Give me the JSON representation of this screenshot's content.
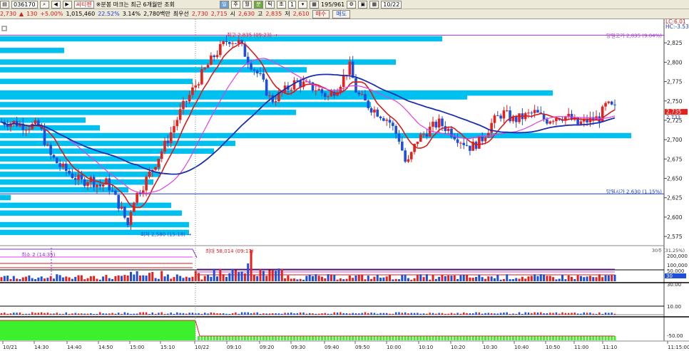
{
  "toolbar1": {
    "code": "036170",
    "name": "씨티젠",
    "status_text": "※분봉 마크는 최근 6개월만 조회",
    "period_value": "1",
    "count_text": "195/961",
    "date": "10/22"
  },
  "toolbar2": {
    "price": "2,730",
    "change": "130",
    "rate": "+5.00%",
    "volume": "1,015,460",
    "vol_rate": "22.52%",
    "turnover": "3.14%",
    "amount": "2,780백만",
    "prev_label": "최우선",
    "ask": "2,730",
    "bid": "2,715",
    "open_label": "시",
    "open": "2,630",
    "high_label": "고",
    "high": "2,835",
    "low_label": "저",
    "low": "2,610",
    "buy_label": "매수",
    "sell_label": "매도"
  },
  "chart_data": {
    "type": "candlestick",
    "price_axis": {
      "min": 2565,
      "max": 2850,
      "ticks": [
        2575,
        2600,
        2625,
        2650,
        2675,
        2700,
        2725,
        2750,
        2775,
        2800,
        2825
      ],
      "tick_labels": [
        "2,575",
        "2,600",
        "2,625",
        "2,650",
        "2,675",
        "2,700",
        "2,725",
        "2,750",
        "2,775",
        "2,800",
        "2,825"
      ]
    },
    "time_labels": [
      "10/21",
      "14:30",
      "14:40",
      "14:50",
      "15:00",
      "15:10",
      "10/22",
      "09:10",
      "09:20",
      "09:30",
      "09:40",
      "09:50",
      "10:00",
      "10:10",
      "10:20",
      "10:30",
      "10:40",
      "10:50",
      "11:00",
      "11:10",
      "11:15:00"
    ],
    "annotations": {
      "high": "최고 2,835 (09:23) →",
      "low": "최저 2,580 (15:18) →",
      "day_high": "당일고가 2,835 (9.04%)",
      "day_open": "당일시가 2,630 (1.15%)",
      "lc_label": "LC:6.01",
      "hc_label": "HC:-3.53",
      "last_price_top": "2,735",
      "last_price_bottom": "2,733",
      "vol_max": "최대 58,014 (09:17)",
      "vol_min": "최소 2 (14:35)",
      "vol_ma": "30주 (31.25%)",
      "vol_ticks": [
        "200,000",
        "100,000",
        "50,000",
        "30"
      ],
      "ind1_ticks": [
        "30.00",
        "10.00"
      ],
      "ind2_ticks": [
        "-50.00"
      ]
    },
    "profile_bars": [
      {
        "price": 2830,
        "len": 620
      },
      {
        "price": 2815,
        "len": 90
      },
      {
        "price": 2800,
        "len": 555
      },
      {
        "price": 2790,
        "len": 430
      },
      {
        "price": 2775,
        "len": 270
      },
      {
        "price": 2760,
        "len": 775
      },
      {
        "price": 2755,
        "len": 655
      },
      {
        "price": 2745,
        "len": 520
      },
      {
        "price": 2735,
        "len": 415
      },
      {
        "price": 2725,
        "len": 120
      },
      {
        "price": 2715,
        "len": 140
      },
      {
        "price": 2705,
        "len": 885
      },
      {
        "price": 2695,
        "len": 330
      },
      {
        "price": 2685,
        "len": 300
      },
      {
        "price": 2675,
        "len": 225
      },
      {
        "price": 2665,
        "len": 225
      },
      {
        "price": 2655,
        "len": 225
      },
      {
        "price": 2645,
        "len": 215
      },
      {
        "price": 2635,
        "len": 180
      },
      {
        "price": 2625,
        "len": 15
      },
      {
        "price": 2615,
        "len": 240
      },
      {
        "price": 2605,
        "len": 255
      },
      {
        "price": 2590,
        "len": 265
      },
      {
        "price": 2580,
        "len": 265
      }
    ]
  }
}
